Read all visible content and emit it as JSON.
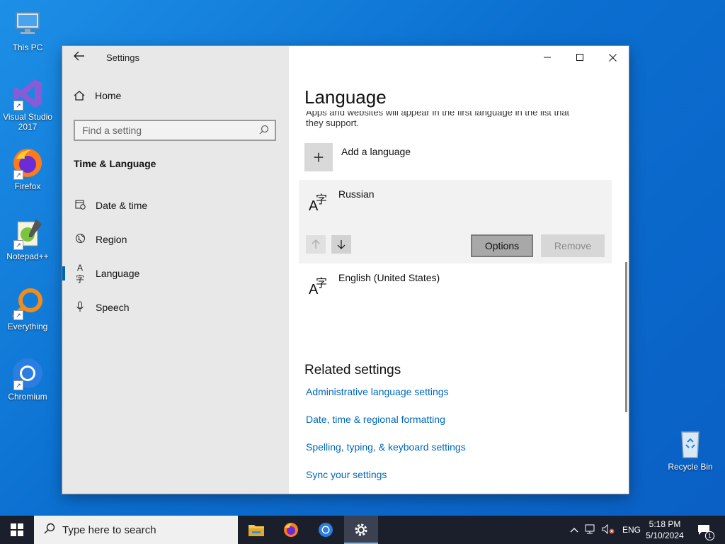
{
  "desktop": {
    "icons": [
      {
        "name": "This PC"
      },
      {
        "name": "Visual Studio 2017"
      },
      {
        "name": "Firefox"
      },
      {
        "name": "Notepad++"
      },
      {
        "name": "Everything"
      },
      {
        "name": "Chromium"
      },
      {
        "name": "Recycle Bin"
      }
    ]
  },
  "window": {
    "title": "Settings",
    "controls": {
      "minimize": "—",
      "maximize": "☐",
      "close": "✕"
    }
  },
  "sidebar": {
    "home_label": "Home",
    "search_placeholder": "Find a setting",
    "section": "Time & Language",
    "items": [
      {
        "label": "Date & time",
        "icon": "calendar-clock-icon"
      },
      {
        "label": "Region",
        "icon": "globe-icon"
      },
      {
        "label": "Language",
        "icon": "language-icon",
        "active": true
      },
      {
        "label": "Speech",
        "icon": "microphone-icon"
      }
    ]
  },
  "main": {
    "title": "Language",
    "intro_line1_partial": "Apps and websites will appear in the first language in the list that",
    "intro_line2": "they support.",
    "add_language_label": "Add a language",
    "languages": [
      {
        "name": "Russian",
        "selected": true
      },
      {
        "name": "English (United States)",
        "selected": false
      }
    ],
    "options_label": "Options",
    "remove_label": "Remove",
    "related_title": "Related settings",
    "related_links": [
      "Administrative language settings",
      "Date, time & regional formatting",
      "Spelling, typing, & keyboard settings",
      "Sync your settings"
    ]
  },
  "taskbar": {
    "search_placeholder": "Type here to search",
    "apps": [
      "file-explorer",
      "firefox",
      "chromium",
      "settings"
    ],
    "tray": {
      "language": "ENG",
      "time": "5:18 PM",
      "date": "5/10/2024",
      "notification_count": "1"
    }
  }
}
